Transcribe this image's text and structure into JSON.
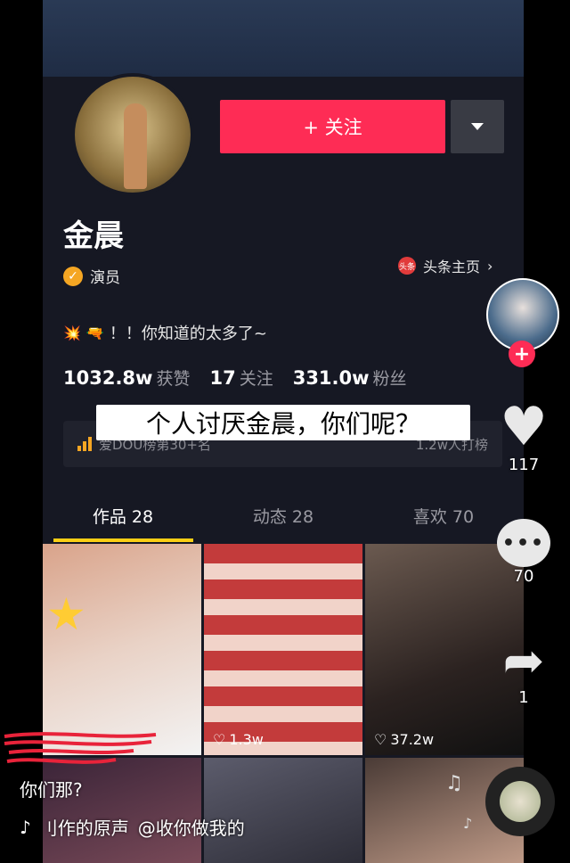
{
  "profile": {
    "follow_label": "+ 关注",
    "name": "金晨",
    "verification": "演员",
    "toutiao_label": "头条主页",
    "toutiao_icon_text": "头条",
    "bio": "！！你知道的太多了~",
    "stats": [
      {
        "num": "1032.8w",
        "label": "获赞"
      },
      {
        "num": "17",
        "label": "关注"
      },
      {
        "num": "331.0w",
        "label": "粉丝"
      }
    ],
    "rank_left": "爱DOU榜第30+名",
    "rank_right": "1.2w人打榜"
  },
  "overlay_text": "个人讨厌金晨，你们呢？",
  "tabs": [
    {
      "label": "作品 28"
    },
    {
      "label": "动态 28"
    },
    {
      "label": "喜欢 70"
    }
  ],
  "grid": [
    {
      "likes": ""
    },
    {
      "likes": "1.3w"
    },
    {
      "likes": "37.2w"
    }
  ],
  "side": {
    "like_count": "117",
    "comment_count": "70",
    "share_count": "1"
  },
  "caption": "你们那?",
  "music": {
    "text": "刂作的原声",
    "mention": "@收你做我的"
  },
  "colors": {
    "accent": "#fe2c55",
    "background": "#161823",
    "tab_underline": "#face15"
  },
  "icons": [
    "heart-icon",
    "comment-icon",
    "share-icon",
    "dropdown-icon",
    "chevron-right-icon",
    "verified-icon",
    "music-note-icon"
  ]
}
